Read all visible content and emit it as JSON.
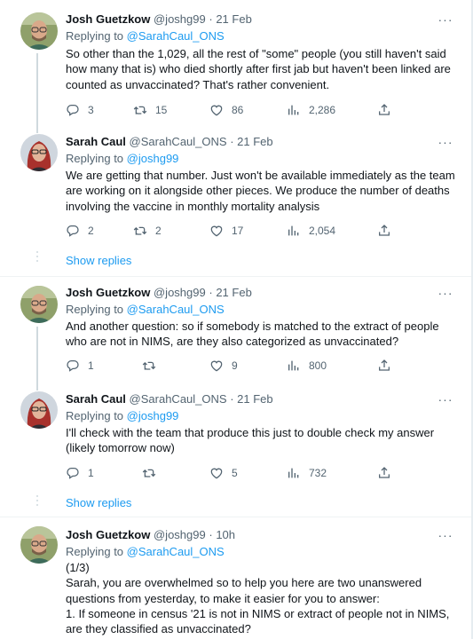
{
  "tweets": [
    {
      "name": "Josh Guetzkow",
      "handle": "@joshg99",
      "dot": "·",
      "time": "21 Feb",
      "replying_prefix": "Replying to",
      "replying_to": "@SarahCaul_ONS",
      "text": "So other than the 1,029, all the rest of \"some\" people (you still haven't said how many that is) who died shortly after first jab but haven't been linked are counted as unvaccinated? That's rather convenient.",
      "reply_count": "3",
      "retweet_count": "15",
      "like_count": "86",
      "view_count": "2,286"
    },
    {
      "name": "Sarah Caul",
      "handle": "@SarahCaul_ONS",
      "dot": "·",
      "time": "21 Feb",
      "replying_prefix": "Replying to",
      "replying_to": "@joshg99",
      "text": "We are getting that number. Just won't be available immediately as the team are working on it alongside other pieces. We produce the number of deaths involving the vaccine in monthly mortality analysis",
      "reply_count": "2",
      "retweet_count": "2",
      "like_count": "17",
      "view_count": "2,054"
    },
    {
      "name": "Josh Guetzkow",
      "handle": "@joshg99",
      "dot": "·",
      "time": "21 Feb",
      "replying_prefix": "Replying to",
      "replying_to": "@SarahCaul_ONS",
      "text": "And another question: so if somebody is matched to the extract of people who are not in NIMS, are they also categorized as unvaccinated?",
      "reply_count": "1",
      "retweet_count": "",
      "like_count": "9",
      "view_count": "800"
    },
    {
      "name": "Sarah Caul",
      "handle": "@SarahCaul_ONS",
      "dot": "·",
      "time": "21 Feb",
      "replying_prefix": "Replying to",
      "replying_to": "@joshg99",
      "text": "I'll check with the team that produce this just to double check my answer (likely tomorrow now)",
      "reply_count": "1",
      "retweet_count": "",
      "like_count": "5",
      "view_count": "732"
    },
    {
      "name": "Josh Guetzkow",
      "handle": "@joshg99",
      "dot": "·",
      "time": "10h",
      "replying_prefix": "Replying to",
      "replying_to": "@SarahCaul_ONS",
      "text_lines": [
        "(1/3)",
        "Sarah, you are overwhelmed so to help you here are two unanswered questions from yesterday, to make it easier for you to answer:",
        "1. If someone in census '21 is not in NIMS or extract of people not in NIMS, are they classified as unvaccinated?"
      ]
    }
  ],
  "show_replies_1": "Show replies",
  "show_replies_2": "Show replies",
  "more_icon": "···",
  "icons": {
    "reply": "reply-icon",
    "retweet": "retweet-icon",
    "like": "heart-icon",
    "views": "views-icon",
    "share": "share-icon"
  },
  "colors": {
    "link": "#1d9bf0",
    "secondary": "#536471",
    "text": "#0f1419"
  }
}
